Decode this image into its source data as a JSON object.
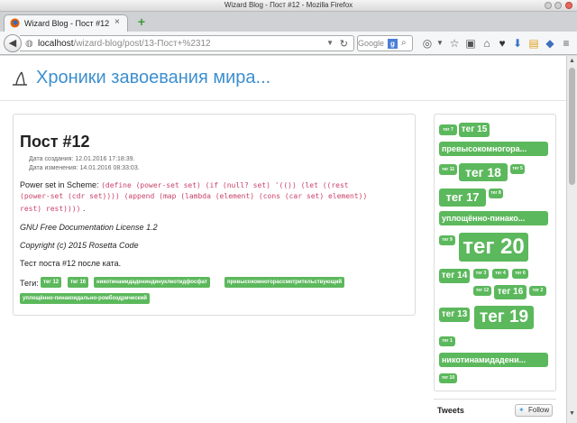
{
  "window": {
    "title": "Wizard Blog - Пост #12 - Mozilla Firefox"
  },
  "tab": {
    "title": "Wizard Blog - Пост #12",
    "close": "×",
    "new_tab": "+"
  },
  "navbar": {
    "url_host": "localhost",
    "url_path": "/wizard-blog/post/13-Пост+%2312",
    "search_engine": "Google",
    "search_badge": "g"
  },
  "site": {
    "title": "Хроники завоевания мира..."
  },
  "post": {
    "title": "Пост #12",
    "created": "Дата создания: 12.01.2016 17:18:39.",
    "modified": "Дата изменения: 14.01.2016 08:33:03.",
    "intro": "Power set in Scheme:",
    "code_line1": "(define (power-set set) (if (null? set) '(()) (let ((rest",
    "code_line2": "(power-set (cdr set)))) (append (map (lambda (element) (cons (car set) element))",
    "code_line3": "rest) rest))))",
    "code_tail": ".",
    "license": "GNU Free Documentation License 1.2",
    "copyright": "Copyright (c) 2015 Rosetta Code",
    "body": "Тест поста #12 после ката.",
    "tags_label": "Теги:",
    "tags": [
      "тег 12",
      "тег 16",
      "никотинамидадениндинуклеотидфосфат",
      "превысокомногорассмотрительствующий",
      "уплощённо-пинакоидально-ромбоэдрический"
    ]
  },
  "cloud": {
    "tags": [
      "тег 7",
      "тег 15",
      "превысокомногора...",
      "тег 11",
      "тег 18",
      "тег 5",
      "тег 17",
      "тег 8",
      "уплощённо-пинако...",
      "тег 9",
      "тег 20",
      "тег 14",
      "тег 3",
      "тег 4",
      "тег 6",
      "тег 12",
      "тег 16",
      "тег 2",
      "тег 13",
      "тег 19",
      "тег 1",
      "никотинамидадени...",
      "тег 10"
    ]
  },
  "tweets": {
    "title": "Tweets",
    "follow": "Follow"
  },
  "colors": {
    "accent": "#3d8fcf",
    "tag": "#5cb85c",
    "code": "#c9426a"
  }
}
